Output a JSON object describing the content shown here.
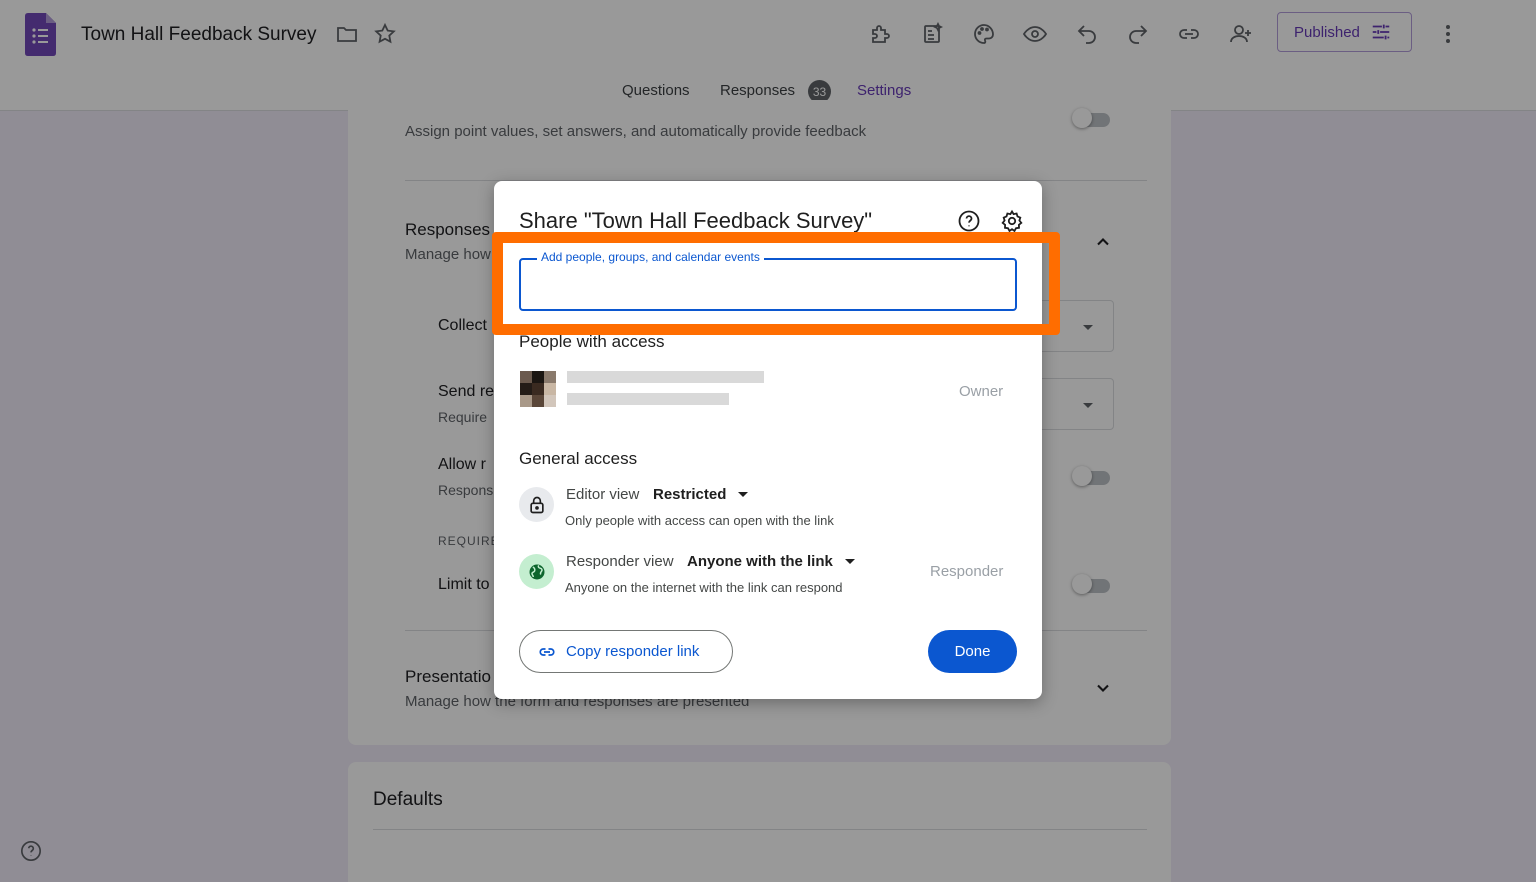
{
  "header": {
    "title": "Town Hall Feedback Survey",
    "published_label": "Published",
    "tabs": [
      {
        "label": "Questions"
      },
      {
        "label": "Responses",
        "badge": "33"
      },
      {
        "label": "Settings"
      }
    ]
  },
  "background": {
    "quiz_desc": "Assign point values, set answers, and automatically provide feedback",
    "responses_title": "Responses",
    "responses_desc": "Manage how",
    "collect": "Collect",
    "send": "Send re",
    "send_desc": "Require",
    "allow": "Allow r",
    "allow_desc": "Respons",
    "requires": "REQUIRE",
    "limit": "Limit to",
    "presentation_title": "Presentatio",
    "presentation_desc": "Manage how the form and responses are presented",
    "defaults_title": "Defaults"
  },
  "dialog": {
    "title": "Share \"Town Hall Feedback Survey\"",
    "add_label": "Add people, groups, and calendar events",
    "people_heading": "People with access",
    "owner_role": "Owner",
    "general_heading": "General access",
    "editor_label": "Editor view",
    "editor_value": "Restricted",
    "editor_desc": "Only people with access can open with the link",
    "responder_label": "Responder view",
    "responder_value": "Anyone with the link",
    "responder_desc": "Anyone on the internet with the link can respond",
    "responder_role": "Responder",
    "copy_label": "Copy responder link",
    "done_label": "Done"
  },
  "colors": {
    "accent_purple": "#673ab7",
    "primary_blue": "#0b57d0",
    "highlight_orange": "#ff6d00"
  }
}
